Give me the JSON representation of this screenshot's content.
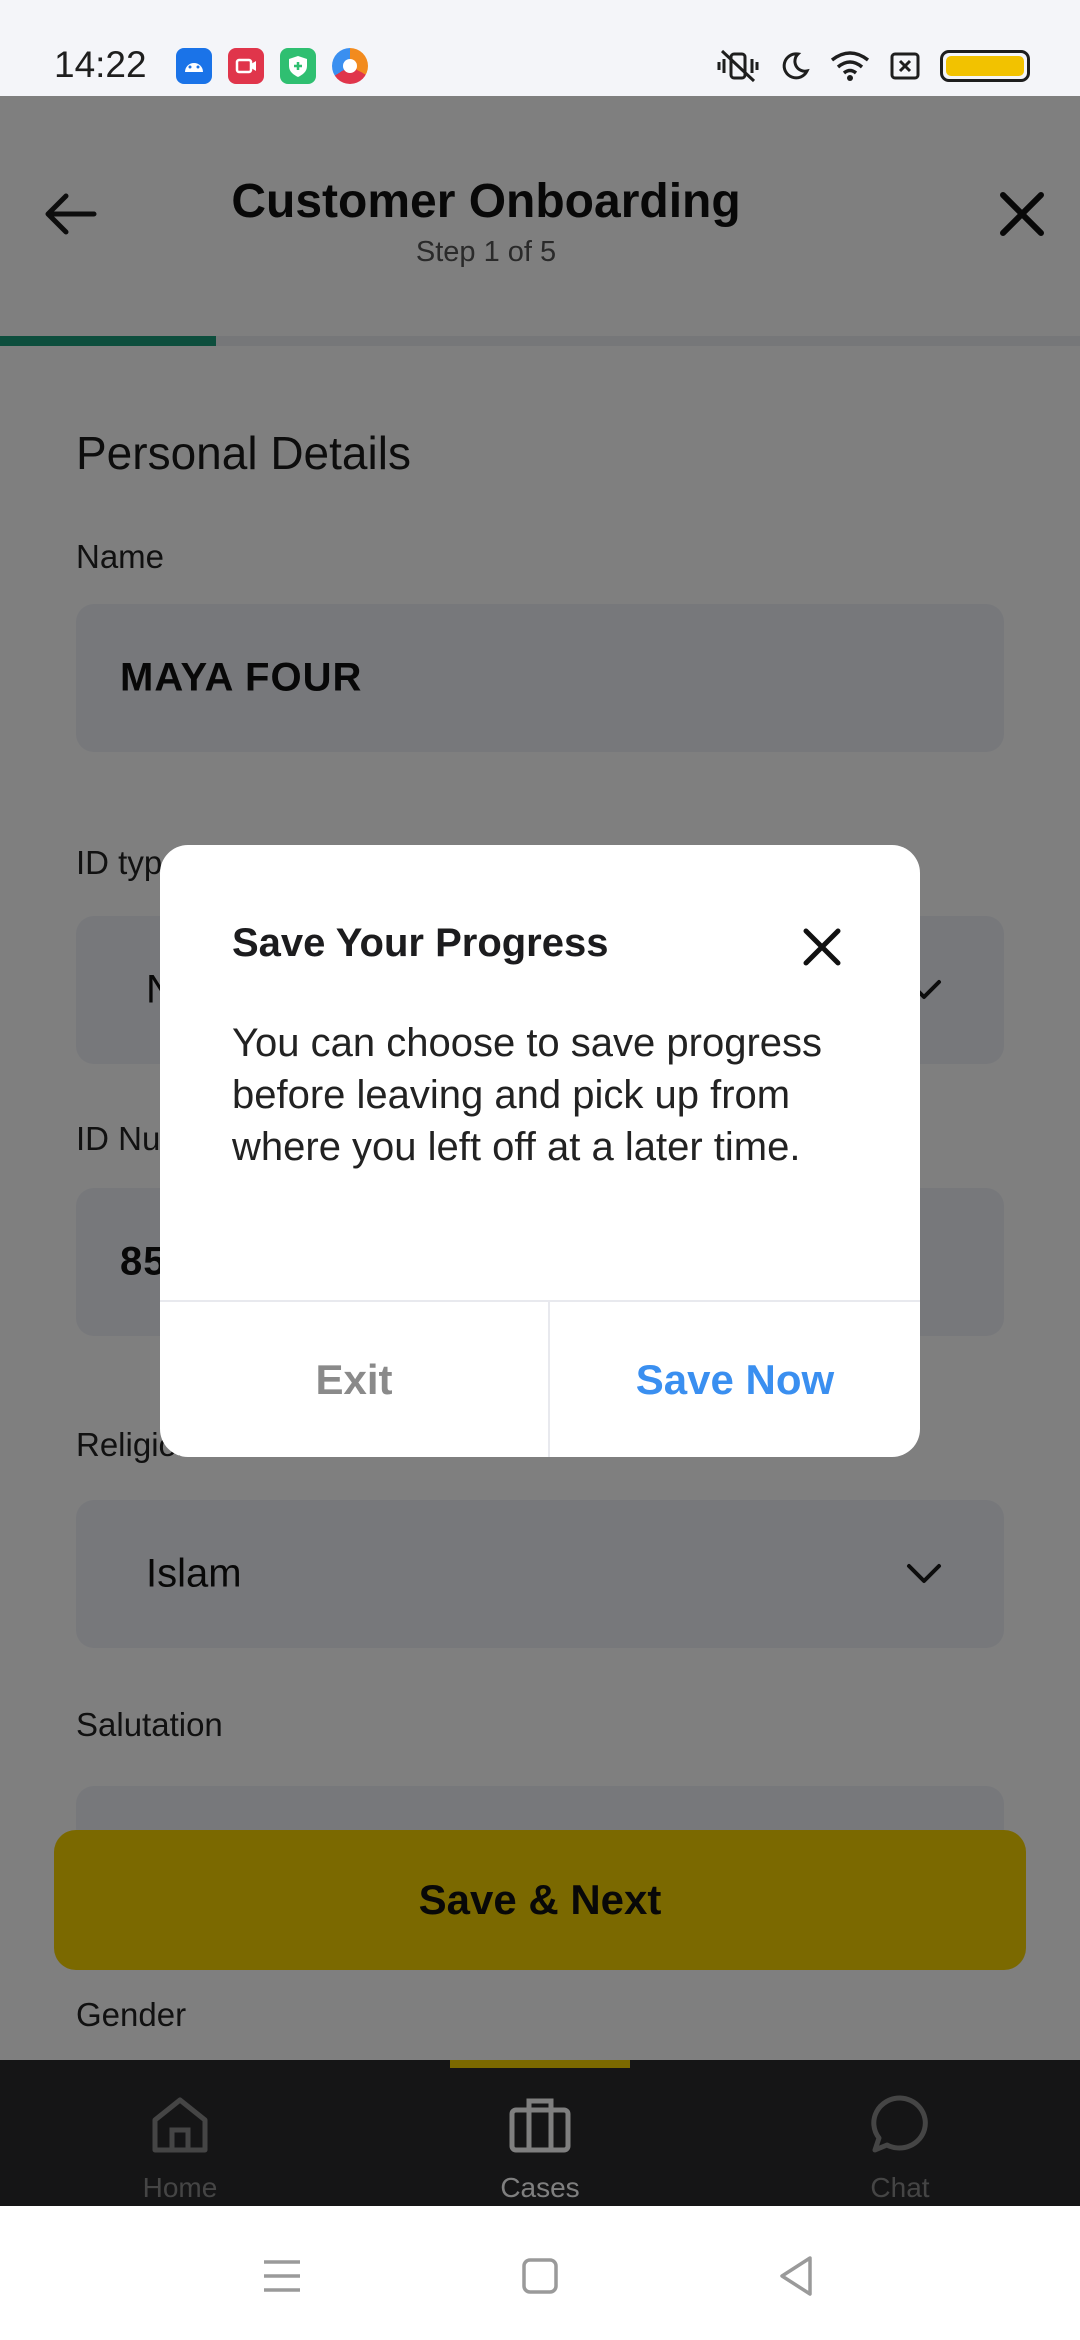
{
  "status_bar": {
    "time": "14:22",
    "app_icons": [
      {
        "name": "android-icon",
        "color": "#1a73e8"
      },
      {
        "name": "screen-recorder-icon",
        "color": "#e0354b"
      },
      {
        "name": "shield-icon",
        "color": "#2fbf71"
      },
      {
        "name": "browser-icon",
        "color": "#f28b1e"
      }
    ],
    "indicators": [
      "vibrate-off-icon",
      "moon-icon",
      "wifi-icon",
      "sim-off-icon",
      "battery-icon"
    ],
    "battery_color": "#f2c200"
  },
  "header": {
    "title": "Customer Onboarding",
    "subtitle": "Step 1 of 5",
    "progress_fraction": 0.2,
    "progress_color": "#1a9c7a"
  },
  "form": {
    "section_title": "Personal Details",
    "name_label": "Name",
    "name_value": "MAYA FOUR",
    "id_type_label": "ID type",
    "id_type_value": "N",
    "id_number_label": "ID Number",
    "id_number_value": "85",
    "religion_label": "Religion",
    "religion_value": "Islam",
    "salutation_label": "Salutation",
    "gender_label": "Gender"
  },
  "save_next_label": "Save & Next",
  "bottom_nav": {
    "items": [
      {
        "label": "Home",
        "icon": "home-icon"
      },
      {
        "label": "Cases",
        "icon": "briefcase-icon",
        "active": true
      },
      {
        "label": "Chat",
        "icon": "chat-icon"
      }
    ],
    "accent": "#f7d200"
  },
  "dialog": {
    "title": "Save Your Progress",
    "body": "You can choose to save progress before leaving and pick up from where you left off at a later time.",
    "exit_label": "Exit",
    "save_label": "Save Now",
    "save_color": "#3a8ff0"
  }
}
